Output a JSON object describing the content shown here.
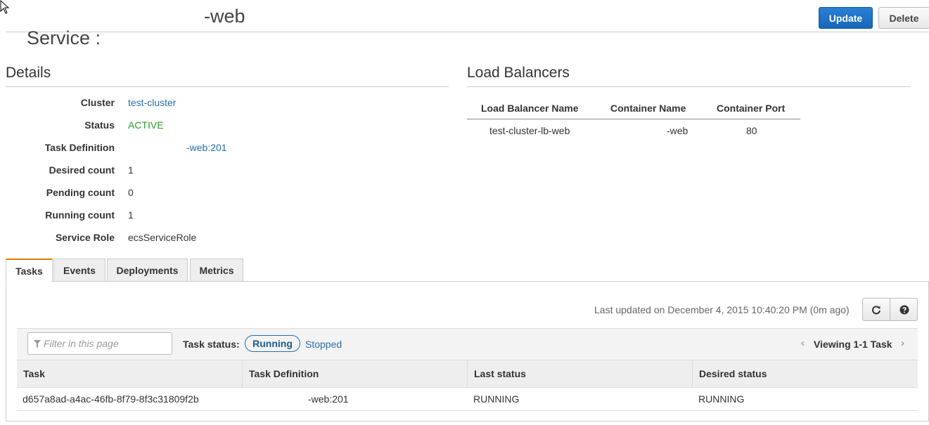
{
  "header": {
    "title_prefix": "Service :",
    "title_name": "-web",
    "update_label": "Update",
    "delete_label": "Delete"
  },
  "details": {
    "title": "Details",
    "rows": [
      {
        "label": "Cluster",
        "value": "test-cluster"
      },
      {
        "label": "Status",
        "value": "ACTIVE"
      },
      {
        "label": "Task Definition",
        "value": "-web:201"
      },
      {
        "label": "Desired count",
        "value": "1"
      },
      {
        "label": "Pending count",
        "value": "0"
      },
      {
        "label": "Running count",
        "value": "1"
      },
      {
        "label": "Service Role",
        "value": "ecsServiceRole"
      }
    ]
  },
  "load_balancers": {
    "title": "Load Balancers",
    "columns": [
      "Load Balancer Name",
      "Container Name",
      "Container Port"
    ],
    "rows": [
      {
        "name": "test-cluster-lb-web",
        "container": "-web",
        "port": "80"
      }
    ]
  },
  "tabs": [
    {
      "label": "Tasks",
      "selected": true
    },
    {
      "label": "Events",
      "selected": false
    },
    {
      "label": "Deployments",
      "selected": false
    },
    {
      "label": "Metrics",
      "selected": false
    }
  ],
  "tasks_panel": {
    "last_updated": "Last updated on December 4, 2015 10:40:20 PM (0m ago)",
    "filter_placeholder": "Filter in this page",
    "task_status_label": "Task status:",
    "status_running": "Running",
    "status_stopped": "Stopped",
    "pager_text": "Viewing 1-1 Task",
    "columns": [
      "Task",
      "Task Definition",
      "Last status",
      "Desired status"
    ],
    "rows": [
      {
        "task": "d657a8ad-a4ac-46fb-8f79-8f3c31809f2b",
        "task_definition": "-web:201",
        "last_status": "RUNNING",
        "desired_status": "RUNNING"
      }
    ]
  },
  "icons": {
    "refresh": "refresh-icon",
    "help": "help-icon",
    "filter": "filter-icon",
    "prev": "chevron-left-icon",
    "next": "chevron-right-icon"
  },
  "colors": {
    "primary_button": "#1866b8",
    "link": "#2a6ea6",
    "active_status": "#2a9a2a",
    "selected_tab_accent": "#e07b00"
  }
}
